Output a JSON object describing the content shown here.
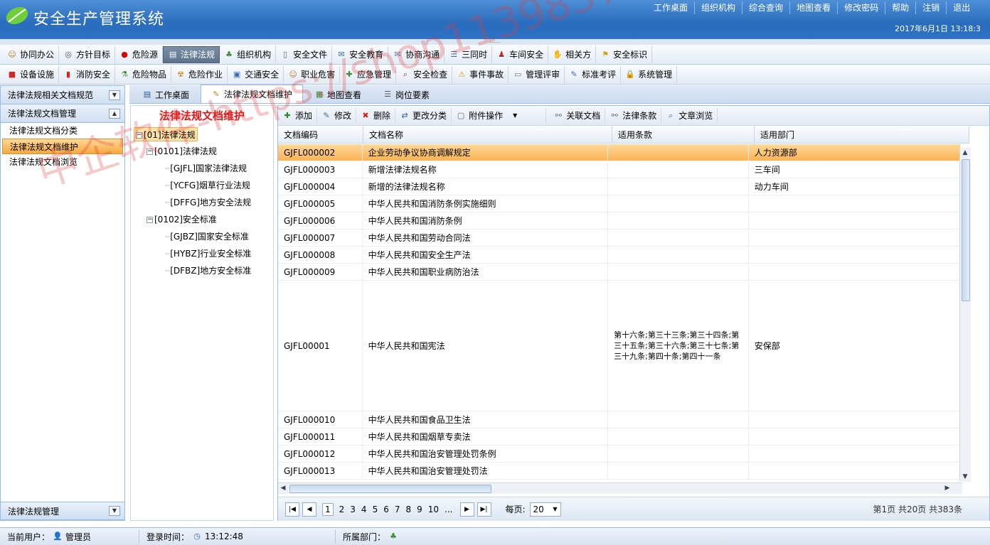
{
  "app": {
    "title": "安全生产管理系统",
    "datetime": "2017年6月1日  13:18:3"
  },
  "top_links": [
    "工作桌面",
    "组织机构",
    "综合查询",
    "地图查看",
    "修改密码",
    "帮助",
    "注销",
    "退出"
  ],
  "menu_row1": [
    {
      "label": "协同办公",
      "icon": "people-icon"
    },
    {
      "label": "方针目标",
      "icon": "target-icon"
    },
    {
      "label": "危险源",
      "icon": "red-dot-icon"
    },
    {
      "label": "法律法规",
      "icon": "law-icon",
      "active": true
    },
    {
      "label": "组织机构",
      "icon": "org-icon"
    },
    {
      "label": "安全文件",
      "icon": "doc-icon"
    },
    {
      "label": "安全教育",
      "icon": "education-icon"
    },
    {
      "label": "协商沟通",
      "icon": "mail-icon"
    },
    {
      "label": "三同时",
      "icon": "list-icon"
    },
    {
      "label": "车间安全",
      "icon": "workshop-icon"
    },
    {
      "label": "相关方",
      "icon": "handshake-icon"
    },
    {
      "label": "安全标识",
      "icon": "flag-icon"
    }
  ],
  "menu_row2": [
    {
      "label": "设备设施",
      "icon": "device-icon"
    },
    {
      "label": "消防安全",
      "icon": "fire-icon"
    },
    {
      "label": "危险物品",
      "icon": "flask-icon"
    },
    {
      "label": "危险作业",
      "icon": "hazard-icon"
    },
    {
      "label": "交通安全",
      "icon": "traffic-icon"
    },
    {
      "label": "职业危害",
      "icon": "worker-icon"
    },
    {
      "label": "应急管理",
      "icon": "emergency-icon"
    },
    {
      "label": "安全检查",
      "icon": "search-icon"
    },
    {
      "label": "事件事故",
      "icon": "warning-icon"
    },
    {
      "label": "管理评审",
      "icon": "review-icon"
    },
    {
      "label": "标准考评",
      "icon": "edit-icon"
    },
    {
      "label": "系统管理",
      "icon": "lock-icon"
    }
  ],
  "sidebar": {
    "section1": "法律法规相关文档规范",
    "section2": "法律法规文档管理",
    "items": [
      "法律法规文档分类",
      "法律法规文档维护",
      "法律法规文档浏览"
    ],
    "bottom": "法律法规管理"
  },
  "tabs": [
    {
      "label": "工作桌面"
    },
    {
      "label": "法律法规文档维护"
    },
    {
      "label": "地图查看"
    },
    {
      "label": "岗位要素"
    }
  ],
  "tree": {
    "title": "法律法规文档维护",
    "nodes": [
      {
        "label": "[01]法律法规"
      },
      {
        "label": "[0101]法律法规"
      },
      {
        "label": "[GJFL]国家法律法规"
      },
      {
        "label": "[YCFG]烟草行业法规"
      },
      {
        "label": "[DFFG]地方安全法规"
      },
      {
        "label": "[0102]安全标准"
      },
      {
        "label": "[GJBZ]国家安全标准"
      },
      {
        "label": "[HYBZ]行业安全标准"
      },
      {
        "label": "[DFBZ]地方安全标准"
      }
    ]
  },
  "toolbar": [
    "添加",
    "修改",
    "删除",
    "更改分类",
    "附件操作",
    "关联文档",
    "法律条款",
    "文章浏览"
  ],
  "columns": [
    "文档编码",
    "文档名称",
    "适用条款",
    "适用部门"
  ],
  "rows": [
    {
      "code": "GJFL000002",
      "name": "企业劳动争议协商调解规定",
      "clause": "",
      "dept": "人力资源部"
    },
    {
      "code": "GJFL000003",
      "name": "新增法律法规名称",
      "clause": "",
      "dept": "三车间"
    },
    {
      "code": "GJFL000004",
      "name": "新增的法律法规名称",
      "clause": "",
      "dept": "动力车间"
    },
    {
      "code": "GJFL000005",
      "name": "中华人民共和国消防条例实施细则",
      "clause": "",
      "dept": ""
    },
    {
      "code": "GJFL000006",
      "name": "中华人民共和国消防条例",
      "clause": "",
      "dept": ""
    },
    {
      "code": "GJFL000007",
      "name": "中华人民共和国劳动合同法",
      "clause": "",
      "dept": ""
    },
    {
      "code": "GJFL000008",
      "name": "中华人民共和国安全生产法",
      "clause": "",
      "dept": ""
    },
    {
      "code": "GJFL000009",
      "name": "中华人民共和国职业病防治法",
      "clause": "",
      "dept": ""
    },
    {
      "code": "GJFL00001",
      "name": "中华人民共和国宪法",
      "clause": "第十六条;第三十三条;第三十四条;第三十五条;第三十六条;第三十七条;第三十九条;第四十条;第四十一条",
      "dept": "安保部"
    },
    {
      "code": "GJFL000010",
      "name": "中华人民共和国食品卫生法",
      "clause": "",
      "dept": ""
    },
    {
      "code": "GJFL000011",
      "name": "中华人民共和国烟草专卖法",
      "clause": "",
      "dept": ""
    },
    {
      "code": "GJFL000012",
      "name": "中华人民共和国治安管理处罚条例",
      "clause": "",
      "dept": ""
    },
    {
      "code": "GJFL000013",
      "name": "中华人民共和国治安管理处罚法",
      "clause": "",
      "dept": ""
    }
  ],
  "pager": {
    "pages": [
      "1",
      "2",
      "3",
      "4",
      "5",
      "6",
      "7",
      "8",
      "9",
      "10",
      "..."
    ],
    "per_page_label": "每页:",
    "per_page": "20",
    "summary": "第1页 共20页 共383条"
  },
  "status": {
    "user_label": "当前用户：",
    "user": "管理员",
    "login_label": "登录时间：",
    "login_time": "13:12:48",
    "dept_label": "所属部门："
  },
  "watermark": "中企软件-https://shop113983775.taobao.com"
}
